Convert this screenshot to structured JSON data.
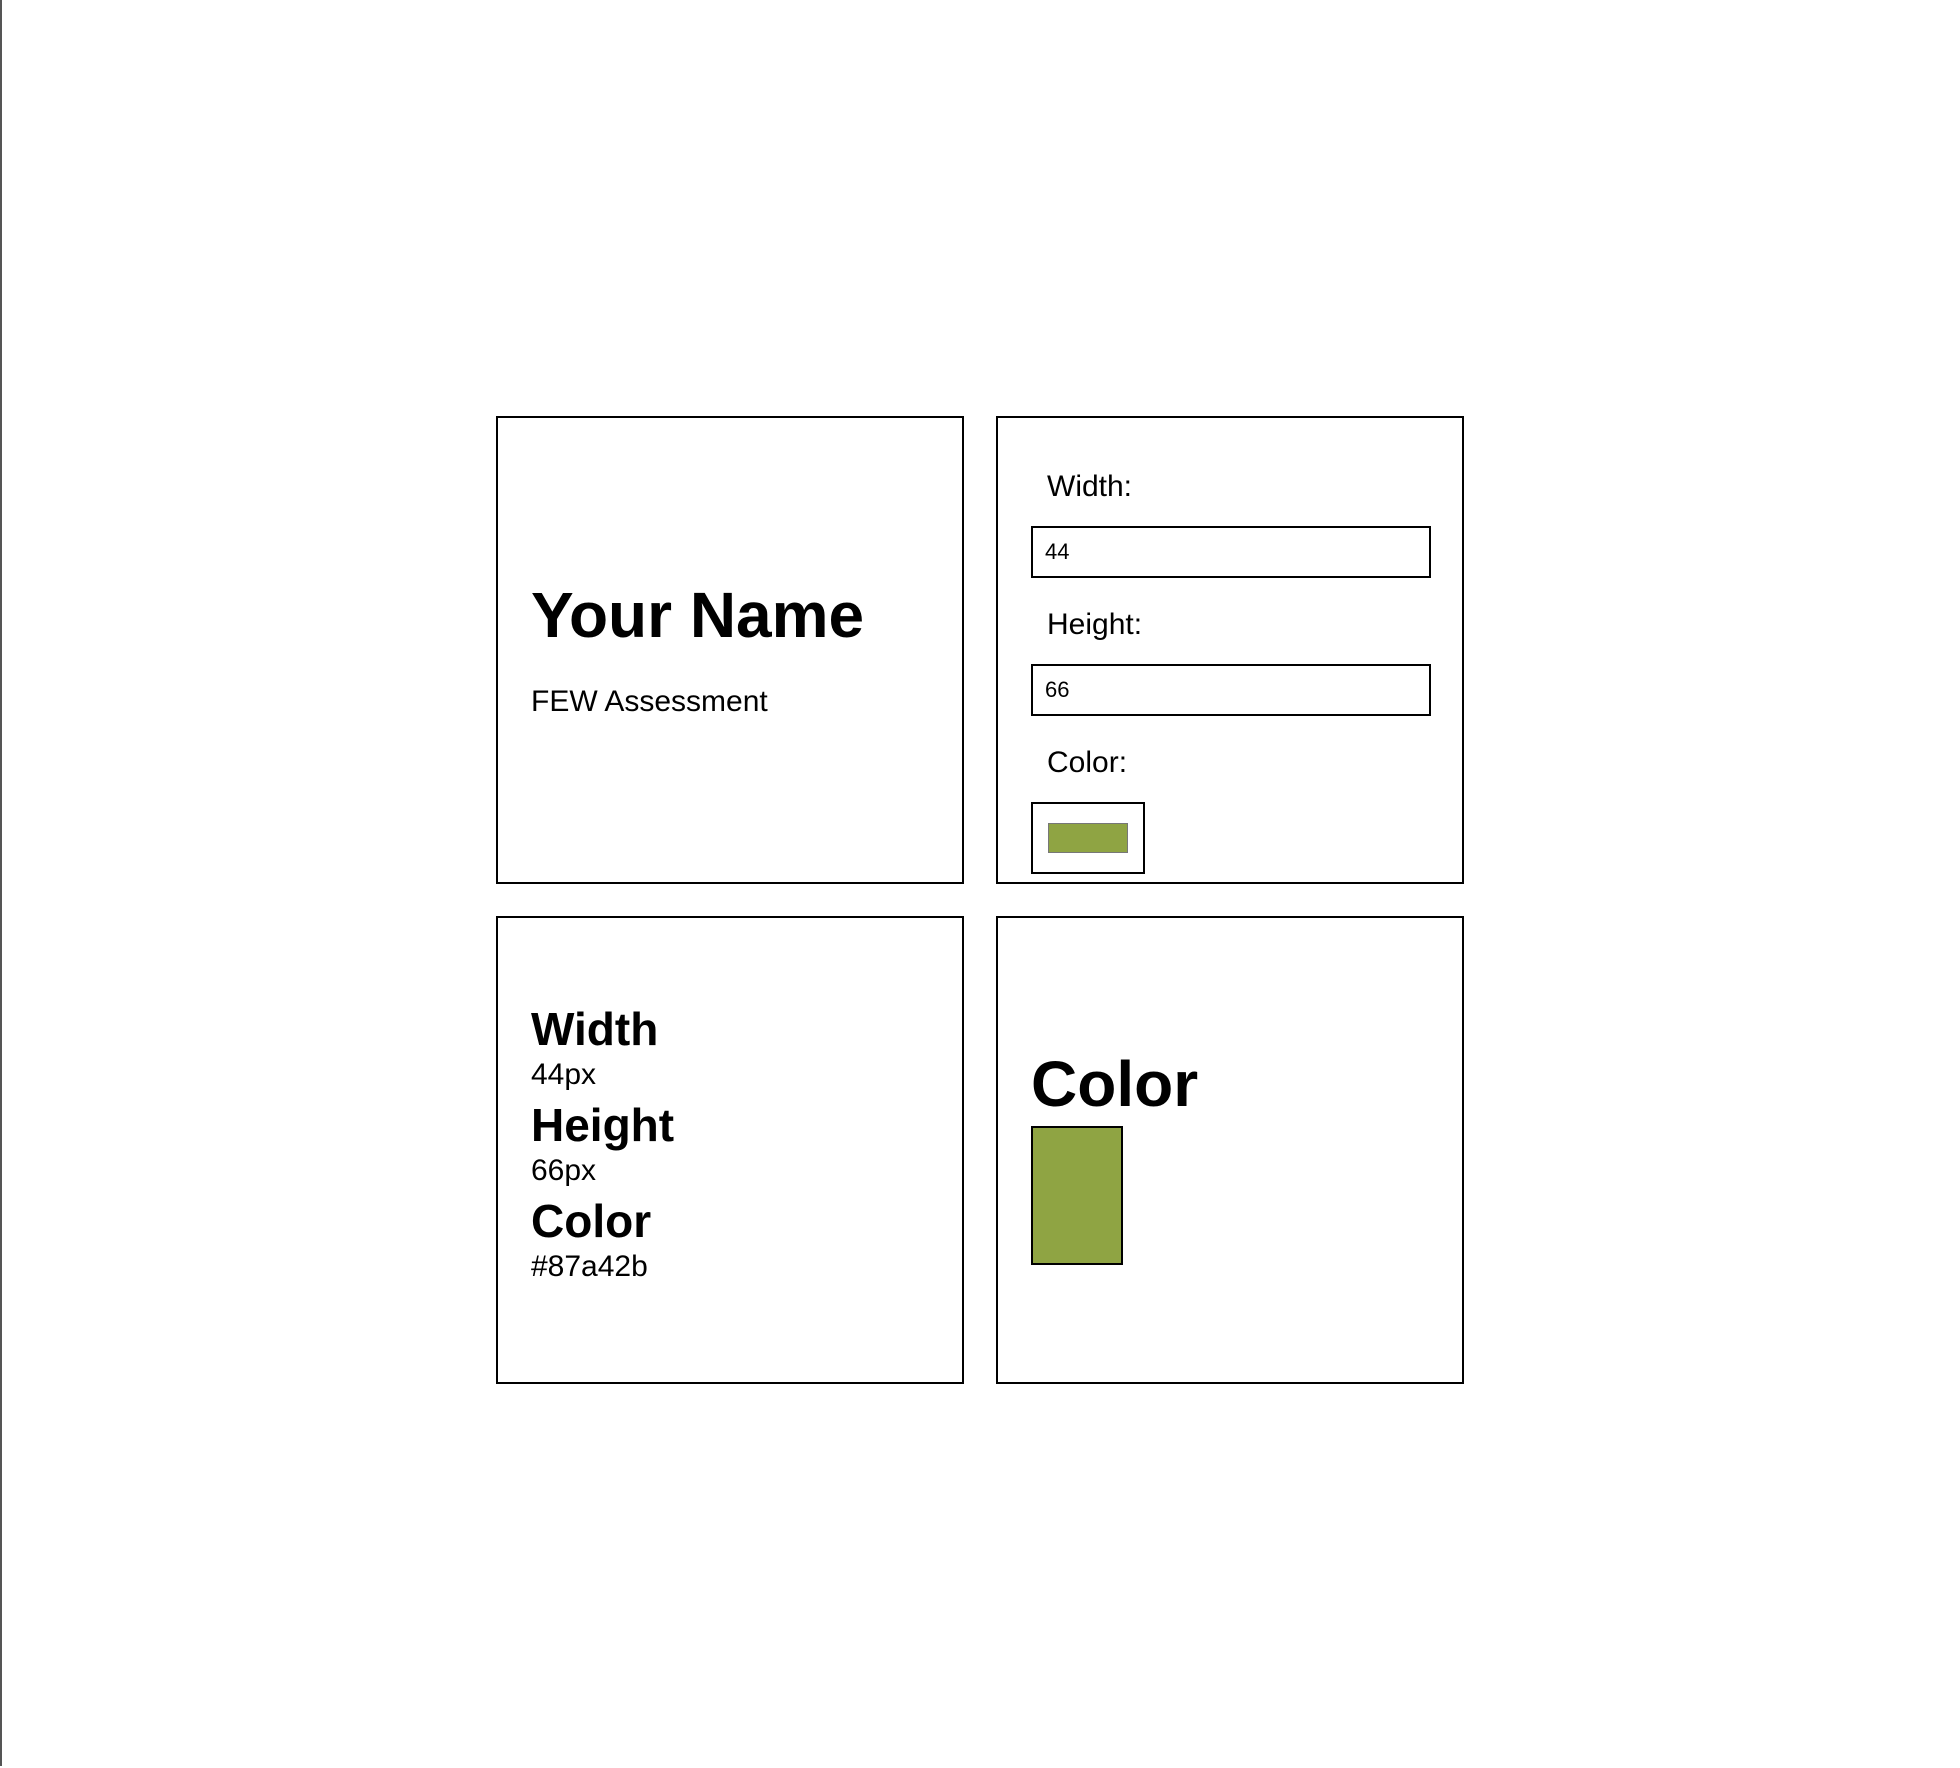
{
  "name_card": {
    "title": "Your Name",
    "subtitle": "FEW Assessment"
  },
  "form": {
    "width_label": "Width:",
    "width_value": "44",
    "height_label": "Height:",
    "height_value": "66",
    "color_label": "Color:",
    "color_value": "#87a42b"
  },
  "values": {
    "width_heading": "Width",
    "width_text": "44px",
    "height_heading": "Height",
    "height_text": "66px",
    "color_heading": "Color",
    "color_text": "#87a42b"
  },
  "preview": {
    "heading": "Color",
    "box_width": 44,
    "box_height": 66,
    "box_color": "#8fa443"
  }
}
